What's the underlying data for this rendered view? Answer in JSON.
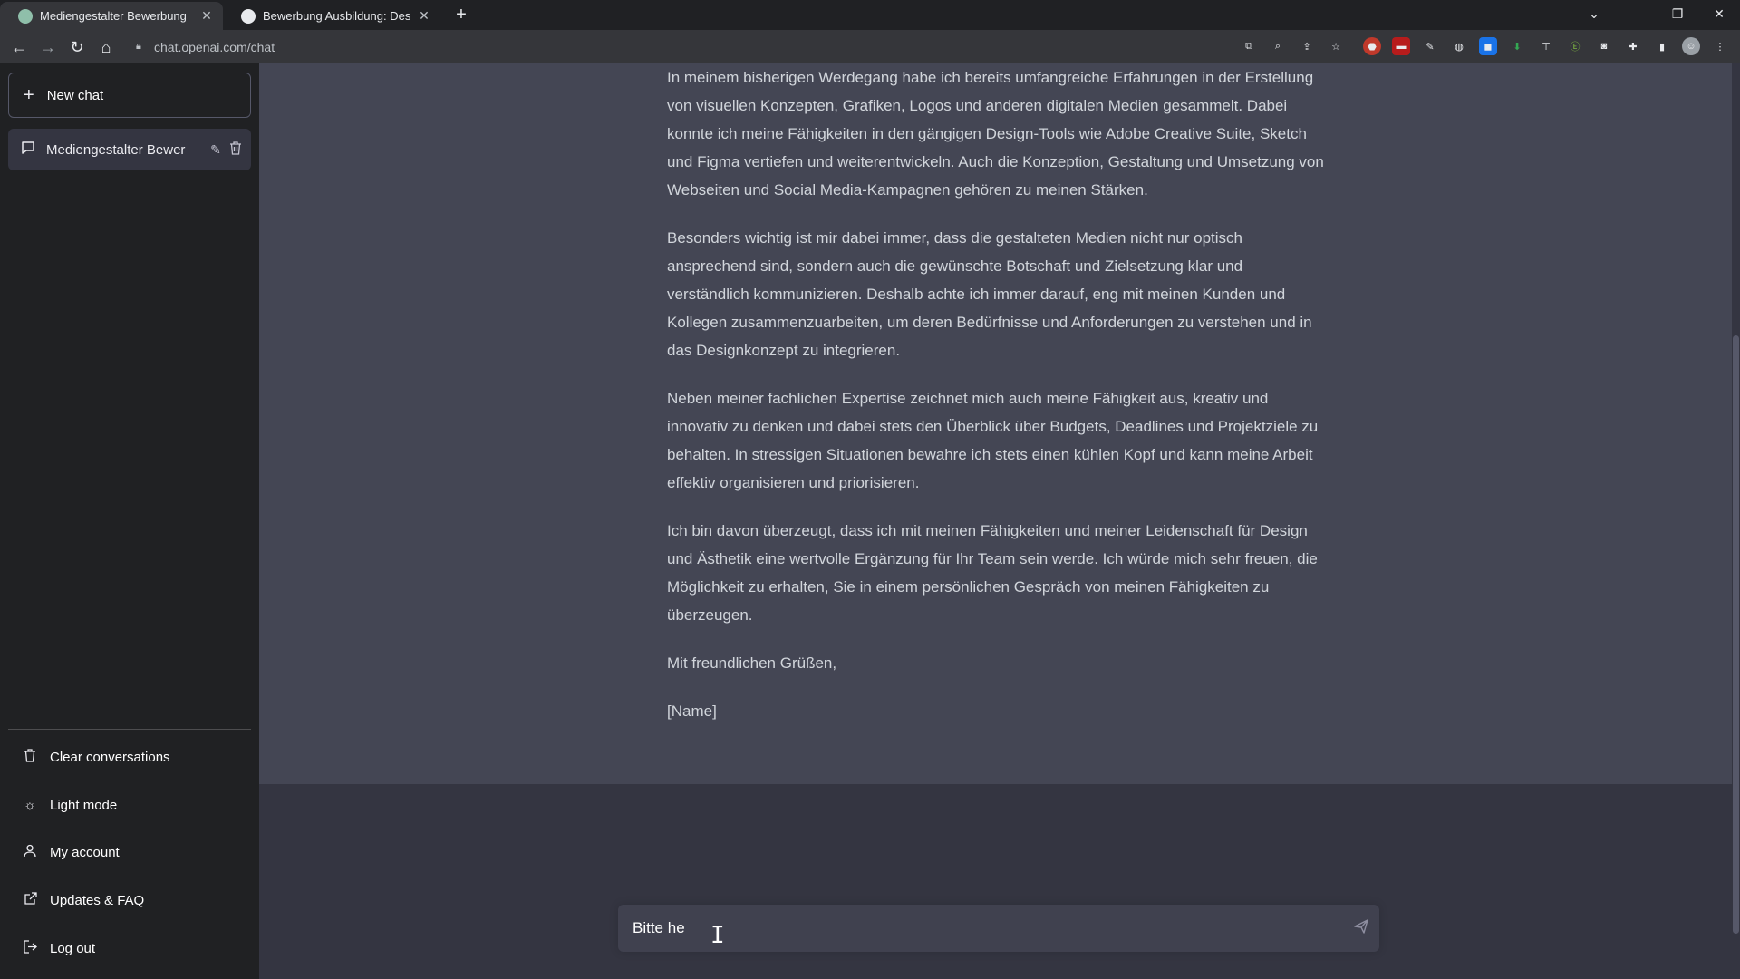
{
  "browser": {
    "tabs": [
      {
        "title": "Mediengestalter Bewerbung",
        "active": true
      },
      {
        "title": "Bewerbung Ausbildung: Design-",
        "active": false
      }
    ],
    "url": "chat.openai.com/chat"
  },
  "sidebar": {
    "new_chat": "New chat",
    "conversations": [
      {
        "title": "Mediengestalter Bewer"
      }
    ],
    "links": [
      {
        "label": "Clear conversations",
        "icon": "trash-icon"
      },
      {
        "label": "Light mode",
        "icon": "sun-icon"
      },
      {
        "label": "My account",
        "icon": "user-icon"
      },
      {
        "label": "Updates & FAQ",
        "icon": "external-link-icon"
      },
      {
        "label": "Log out",
        "icon": "logout-icon"
      }
    ]
  },
  "chat": {
    "paragraphs": [
      "In meinem bisherigen Werdegang habe ich bereits umfangreiche Erfahrungen in der Erstellung von visuellen Konzepten, Grafiken, Logos und anderen digitalen Medien gesammelt. Dabei konnte ich meine Fähigkeiten in den gängigen Design-Tools wie Adobe Creative Suite, Sketch und Figma vertiefen und weiterentwickeln. Auch die Konzeption, Gestaltung und Umsetzung von Webseiten und Social Media-Kampagnen gehören zu meinen Stärken.",
      "Besonders wichtig ist mir dabei immer, dass die gestalteten Medien nicht nur optisch ansprechend sind, sondern auch die gewünschte Botschaft und Zielsetzung klar und verständlich kommunizieren. Deshalb achte ich immer darauf, eng mit meinen Kunden und Kollegen zusammenzuarbeiten, um deren Bedürfnisse und Anforderungen zu verstehen und in das Designkonzept zu integrieren.",
      "Neben meiner fachlichen Expertise zeichnet mich auch meine Fähigkeit aus, kreativ und innovativ zu denken und dabei stets den Überblick über Budgets, Deadlines und Projektziele zu behalten. In stressigen Situationen bewahre ich stets einen kühlen Kopf und kann meine Arbeit effektiv organisieren und priorisieren.",
      "Ich bin davon überzeugt, dass ich mit meinen Fähigkeiten und meiner Leidenschaft für Design und Ästhetik eine wertvolle Ergänzung für Ihr Team sein werde. Ich würde mich sehr freuen, die Möglichkeit zu erhalten, Sie in einem persönlichen Gespräch von meinen Fähigkeiten zu überzeugen.",
      "Mit freundlichen Grüßen,",
      "[Name]"
    ],
    "input_value": "Bitte he"
  },
  "colors": {
    "sidebar_bg": "#202123",
    "main_bg": "#343541",
    "message_bg": "#444654",
    "input_bg": "#40414f"
  }
}
